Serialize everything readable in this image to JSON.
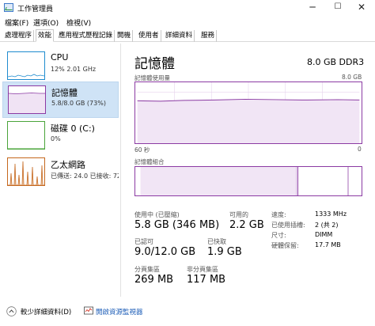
{
  "window": {
    "title": "工作管理員",
    "min": "─",
    "max": "☐",
    "close": "✕"
  },
  "menu": [
    "檔案(F)",
    "選項(O)",
    "檢視(V)"
  ],
  "tabs": [
    "處理程序",
    "效能",
    "應用程式歷程記錄",
    "開機",
    "使用者",
    "詳細資料",
    "服務"
  ],
  "active_tab": 1,
  "resources": [
    {
      "name": "CPU",
      "sub": "12%  2.01 GHz",
      "color": "#1f8ccf"
    },
    {
      "name": "記憶體",
      "sub": "5.8/8.0 GB (73%)",
      "color": "#8b3aa3"
    },
    {
      "name": "磁碟 0 (C:)",
      "sub": "0%",
      "color": "#4aa43a"
    },
    {
      "name": "乙太網路",
      "sub": "已傳送: 24.0  已接收: 72",
      "color": "#c5671d"
    }
  ],
  "memory": {
    "title": "記憶體",
    "capacity": "8.0 GB DDR3",
    "usage_label": "記憶體使用量",
    "usage_max": "8.0 GB",
    "time_left": "60 秒",
    "time_right": "0",
    "composition_label": "記憶體組合",
    "in_use_fraction": 0.73,
    "stats": {
      "in_use_label": "使用中 (已壓縮)",
      "in_use_value": "5.8 GB (346 MB)",
      "available_label": "可用的",
      "available_value": "2.2 GB",
      "committed_label": "已認可",
      "committed_value": "9.0/12.0 GB",
      "cached_label": "已快取",
      "cached_value": "1.9 GB",
      "paged_label": "分頁集區",
      "paged_value": "269 MB",
      "nonpaged_label": "非分頁集區",
      "nonpaged_value": "117 MB"
    },
    "info": {
      "speed_label": "速度:",
      "speed_value": "1333 MHz",
      "slots_label": "已使用插槽:",
      "slots_value": "2 (共 2)",
      "form_label": "尺寸:",
      "form_value": "DIMM",
      "reserved_label": "硬體保留:",
      "reserved_value": "17.7 MB"
    }
  },
  "footer": {
    "fewer_details": "較少詳細資料(D)",
    "open_monitor": "開啟資源監視器"
  },
  "icons": [
    "app-icon",
    "chevron-up-icon",
    "resource-monitor-icon"
  ]
}
